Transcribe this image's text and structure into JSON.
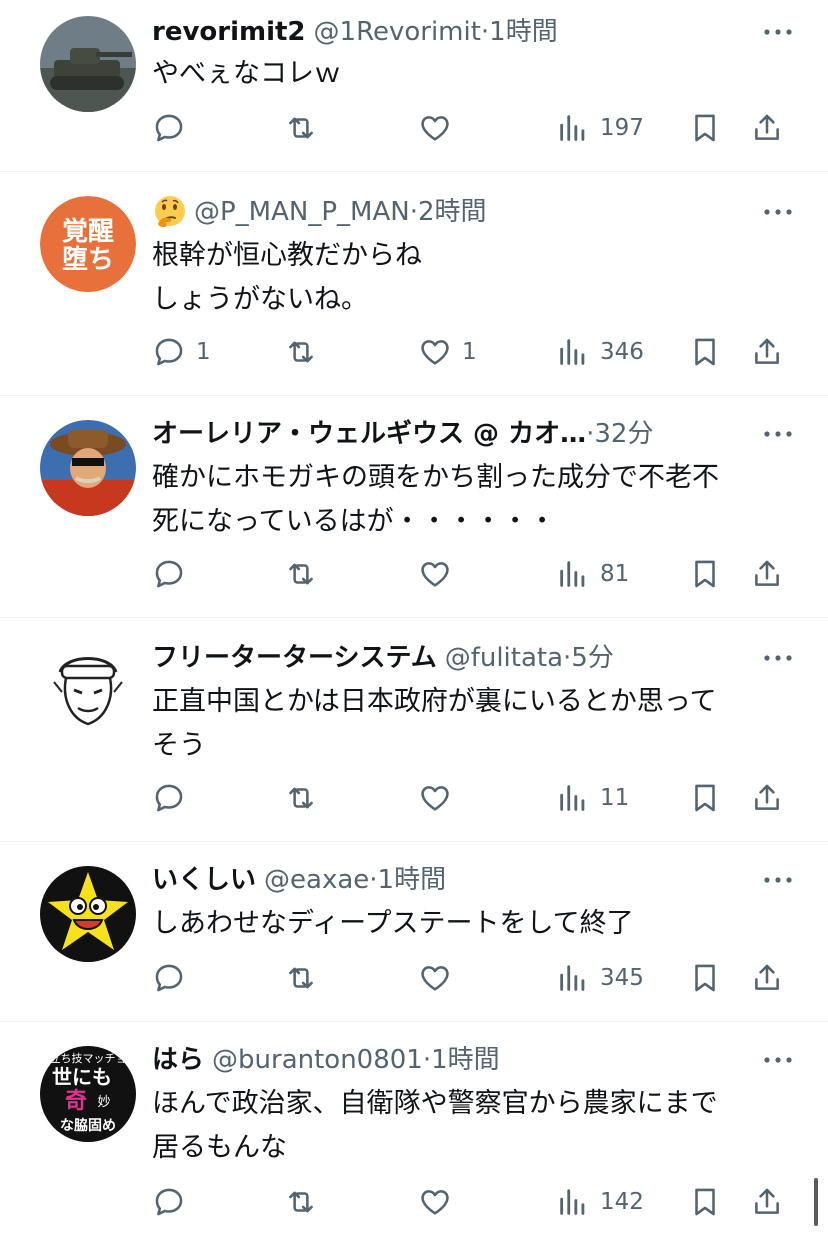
{
  "tweets": [
    {
      "display_name": "revorimit2",
      "handle": "@1Revorimit",
      "time": "·1時間",
      "text": "やべぇなコレｗ",
      "reply_count": "",
      "retweet_count": "",
      "like_count": "",
      "view_count": "197",
      "avatar": "tank-avatar"
    },
    {
      "display_name": "",
      "name_emoji": "thinking-face-icon",
      "handle": "@P_MAN_P_MAN",
      "time": "·2時間",
      "text": "根幹が恒心教だからね\nしょうがないね。",
      "reply_count": "1",
      "retweet_count": "",
      "like_count": "1",
      "view_count": "346",
      "avatar": "orange-kanji-avatar",
      "avatar_text": [
        "覚醒",
        "堕ち"
      ]
    },
    {
      "display_name": "オーレリア・ウェルギウス @ カオ…",
      "handle": "",
      "time": "·32分",
      "text": "確かにホモガキの頭をかち割った成分で不老不\n死になっているはが・・・・・・",
      "reply_count": "",
      "retweet_count": "",
      "like_count": "",
      "view_count": "81",
      "avatar": "cowboy-avatar"
    },
    {
      "display_name": "フリーターターシステム",
      "handle": "@fulitata",
      "time": "·5分",
      "text": "正直中国とかは日本政府が裏にいるとか思って\nそう",
      "reply_count": "",
      "retweet_count": "",
      "like_count": "",
      "view_count": "11",
      "avatar": "sketch-face-avatar"
    },
    {
      "display_name": "いくしい",
      "handle": "@eaxae",
      "time": "·1時間",
      "text": "しあわせなディープステートをして終了",
      "reply_count": "",
      "retweet_count": "",
      "like_count": "",
      "view_count": "345",
      "avatar": "yellow-star-avatar"
    },
    {
      "display_name": "はら",
      "handle": "@buranton0801",
      "time": "·1時間",
      "text": "ほんで政治家、自衛隊や警察官から農家にまで\n居るもんな",
      "reply_count": "",
      "retweet_count": "",
      "like_count": "",
      "view_count": "142",
      "avatar": "manga-panel-avatar",
      "avatar_text": [
        "立ち技マッチョ",
        "世にも",
        "奇",
        "妙",
        "な脇固め"
      ]
    }
  ],
  "colors": {
    "text_primary": "#0f1419",
    "text_secondary": "#536471",
    "divider": "#eff3f4",
    "avatar_orange": "#e8703a"
  }
}
